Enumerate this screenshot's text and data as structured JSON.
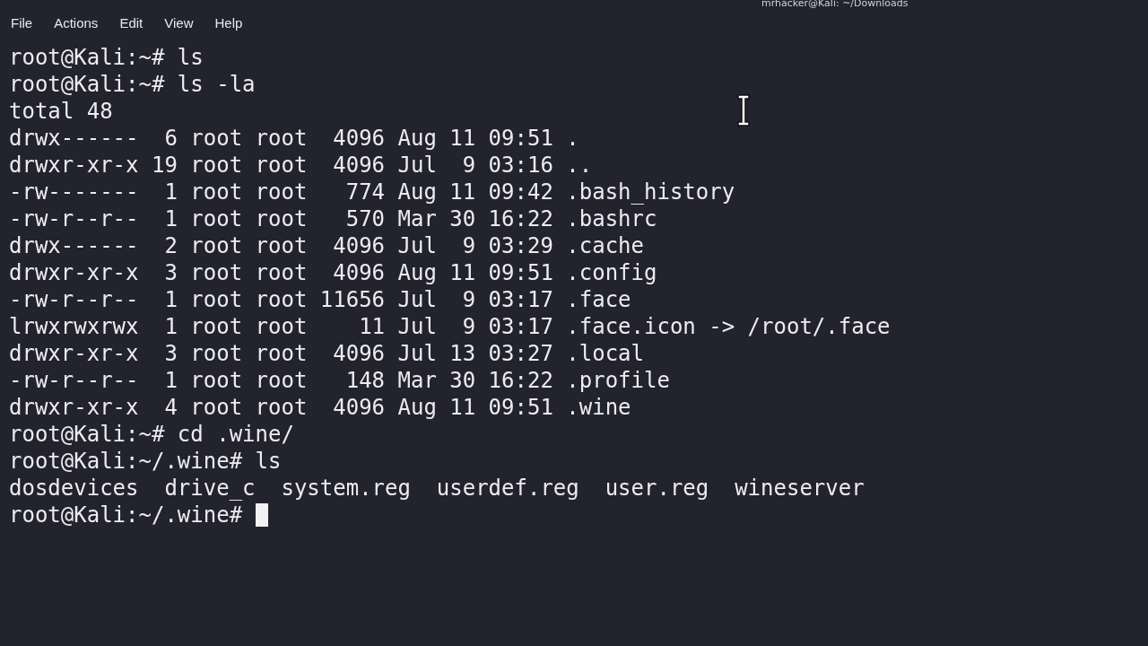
{
  "window": {
    "title": "mrhacker@Kali: ~/Downloads"
  },
  "menu": [
    "File",
    "Actions",
    "Edit",
    "View",
    "Help"
  ],
  "terminal": {
    "lines": [
      "root@Kali:~# ls",
      "root@Kali:~# ls -la",
      "total 48",
      "drwx------  6 root root  4096 Aug 11 09:51 .",
      "drwxr-xr-x 19 root root  4096 Jul  9 03:16 ..",
      "-rw-------  1 root root   774 Aug 11 09:42 .bash_history",
      "-rw-r--r--  1 root root   570 Mar 30 16:22 .bashrc",
      "drwx------  2 root root  4096 Jul  9 03:29 .cache",
      "drwxr-xr-x  3 root root  4096 Aug 11 09:51 .config",
      "-rw-r--r--  1 root root 11656 Jul  9 03:17 .face",
      "lrwxrwxrwx  1 root root    11 Jul  9 03:17 .face.icon -> /root/.face",
      "drwxr-xr-x  3 root root  4096 Jul 13 03:27 .local",
      "-rw-r--r--  1 root root   148 Mar 30 16:22 .profile",
      "drwxr-xr-x  4 root root  4096 Aug 11 09:51 .wine",
      "root@Kali:~# cd .wine/",
      "root@Kali:~/.wine# ls",
      "dosdevices  drive_c  system.reg  userdef.reg  user.reg  wineserver"
    ],
    "prompt": "root@Kali:~/.wine# "
  }
}
